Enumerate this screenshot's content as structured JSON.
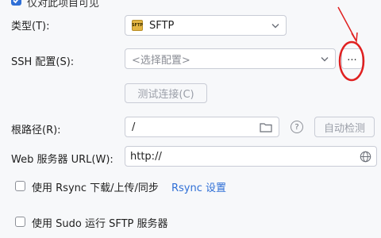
{
  "top_checkbox": {
    "label": "仅对此项目可见",
    "checked": true
  },
  "type": {
    "label": "类型(T):",
    "value": "SFTP",
    "badge": "SFTP",
    "icon": "chevron-down-icon"
  },
  "ssh": {
    "label": "SSH 配置(S):",
    "placeholder": "<选择配置>",
    "browse_label": "...",
    "test_button": "测试连接(C)"
  },
  "root_path": {
    "label": "根路径(R):",
    "value": "/",
    "auto_detect": "自动检测"
  },
  "web_url": {
    "label": "Web 服务器 URL(W):",
    "value": "http://"
  },
  "rsync": {
    "label": "使用 Rsync 下载/上传/同步",
    "settings_link": "Rsync 设置",
    "checked": false
  },
  "sudo": {
    "label": "使用 Sudo 运行 SFTP 服务器",
    "checked": false
  },
  "colors": {
    "accent": "#2f6fd6",
    "annotation": "#e02020",
    "sftp_badge": "#e3b542"
  }
}
